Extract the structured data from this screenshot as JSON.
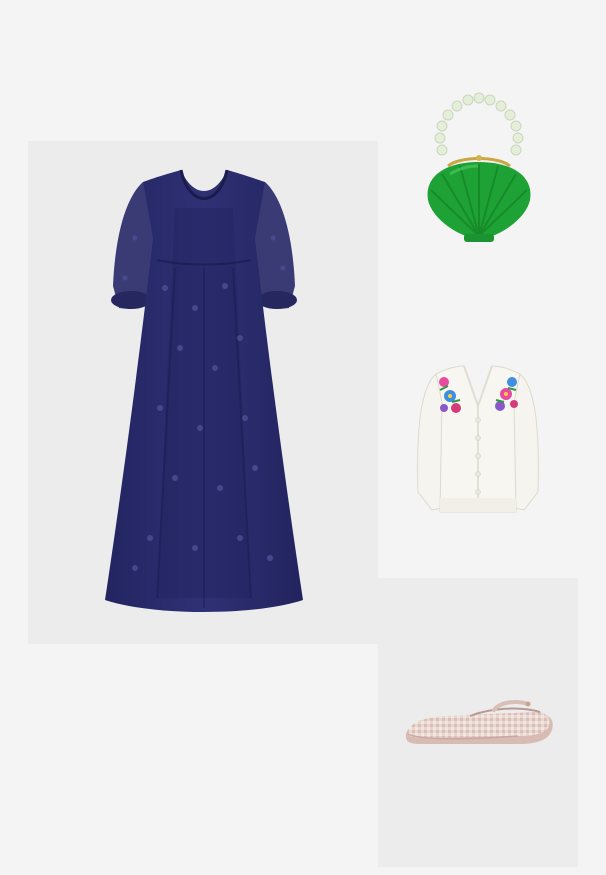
{
  "outfit": {
    "items": [
      {
        "kind": "dress",
        "color": "#2b2c6b",
        "icon": "dress-icon"
      },
      {
        "kind": "handbag",
        "color": "#1fa235",
        "icon": "shell-bag-icon"
      },
      {
        "kind": "cardigan",
        "color": "#f6f4ee",
        "icon": "cardigan-icon"
      },
      {
        "kind": "shoe",
        "color": "#e6d2cc",
        "icon": "flat-shoe-icon"
      }
    ]
  }
}
